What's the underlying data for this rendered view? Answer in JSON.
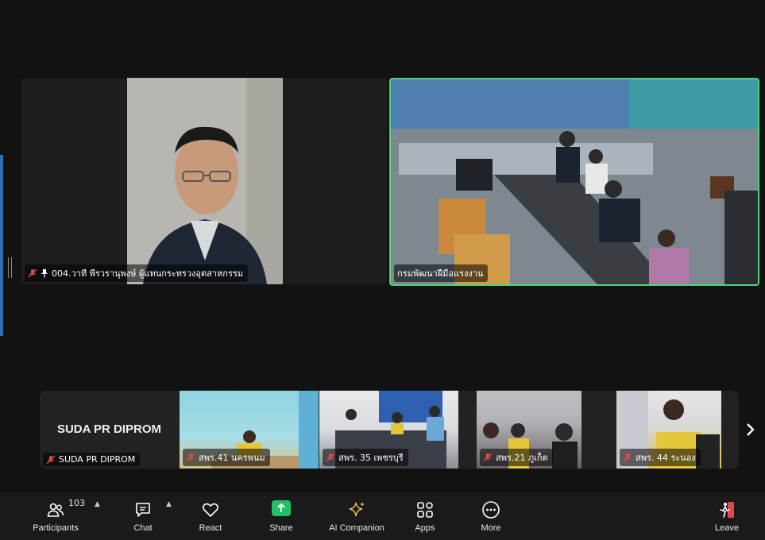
{
  "main_tile": {
    "name": "004.วาที พีรวรานุพงษ์ ผู้แทนกระทรวงอุตสาหกรรม",
    "muted": true,
    "pinned": true
  },
  "room_tile": {
    "name": "กรมพัฒนาฝีมือแรงงาน",
    "active_speaker_color": "#4bd37b"
  },
  "filmstrip": {
    "tiles": [
      {
        "display_name": "SUDA PR DIPROM",
        "name": "SUDA PR DIPROM",
        "muted": true
      },
      {
        "name": "สพร.41 นครพนม",
        "muted": true
      },
      {
        "name": "สพร. 35 เพชรบุรี",
        "muted": true
      },
      {
        "name": "สพร.21 ภูเก็ต",
        "muted": true
      },
      {
        "name": "สพร. 44 ระนอง",
        "muted": true
      }
    ],
    "next_icon": "chevron-right-icon"
  },
  "toolbar": {
    "participants": {
      "label": "Participants",
      "count": "103",
      "icon": "participants-icon"
    },
    "chat": {
      "label": "Chat",
      "icon": "chat-icon"
    },
    "react": {
      "label": "React",
      "icon": "heart-icon"
    },
    "share": {
      "label": "Share",
      "icon": "share-screen-icon",
      "color": "#22c064"
    },
    "ai": {
      "label": "AI Companion",
      "icon": "sparkle-icon"
    },
    "apps": {
      "label": "Apps",
      "icon": "apps-icon"
    },
    "more": {
      "label": "More",
      "icon": "more-icon"
    },
    "leave": {
      "label": "Leave",
      "icon": "leave-icon",
      "color": "#e0484b"
    }
  }
}
